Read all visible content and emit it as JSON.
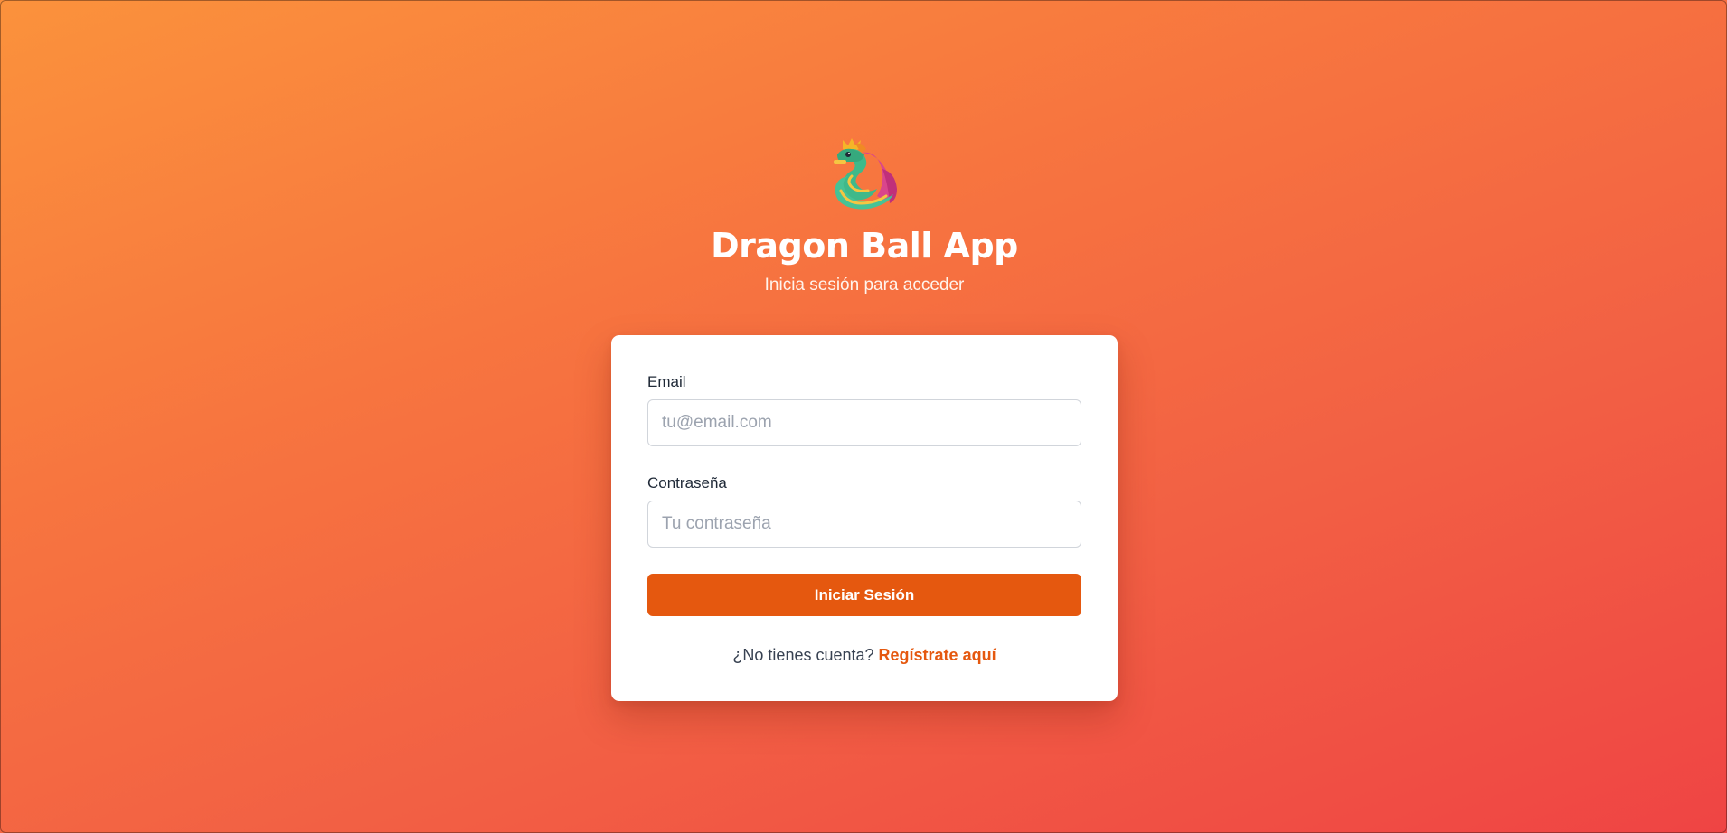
{
  "header": {
    "logo_icon": "dragon-icon",
    "title": "Dragon Ball App",
    "subtitle": "Inicia sesión para acceder"
  },
  "form": {
    "email": {
      "label": "Email",
      "value": "",
      "placeholder": "tu@email.com"
    },
    "password": {
      "label": "Contraseña",
      "value": "",
      "placeholder": "Tu contraseña"
    },
    "submit_label": "Iniciar Sesión"
  },
  "signup": {
    "prompt": "¿No tienes cuenta?",
    "link_label": "Regístrate aquí"
  },
  "colors": {
    "gradient_start": "#fb923c",
    "gradient_end": "#ef4444",
    "accent": "#e5580f",
    "card_background": "#ffffff"
  }
}
